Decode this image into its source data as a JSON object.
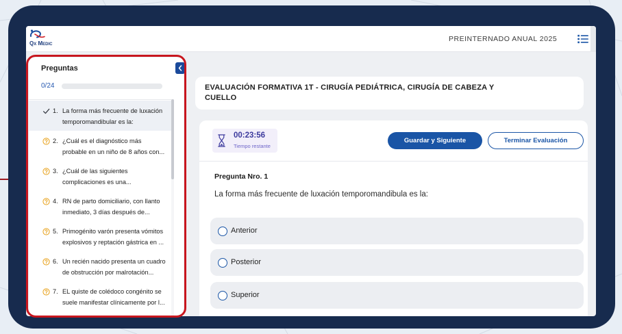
{
  "header": {
    "logo_text": "Qx Medic",
    "course_title": "PREINTERNADO ANUAL 2025",
    "menu_icon": "list-icon"
  },
  "sidebar": {
    "title": "Preguntas",
    "progress_text": "0/24",
    "progress_fraction": 0,
    "collapse_icon": "chevron-left-icon",
    "questions": [
      {
        "number": "1.",
        "lines": [
          "La forma más frecuente de luxación",
          "temporomandibular es la:"
        ],
        "icon": "check-icon",
        "active": true
      },
      {
        "number": "2.",
        "lines": [
          "¿Cuál es el diagnóstico más",
          "probable en un niño de 8 años con..."
        ],
        "icon": "question-circle-icon"
      },
      {
        "number": "3.",
        "lines": [
          "¿Cuál de las siguientes",
          "complicaciones es una..."
        ],
        "icon": "question-circle-icon"
      },
      {
        "number": "4.",
        "lines": [
          "RN de parto domiciliario, con llanto",
          "inmediato, 3 días después de..."
        ],
        "icon": "question-circle-icon"
      },
      {
        "number": "5.",
        "lines": [
          "Primogénito varón presenta vómitos",
          "explosivos y reptación gástrica en ..."
        ],
        "icon": "question-circle-icon"
      },
      {
        "number": "6.",
        "lines": [
          "Un recién nacido presenta un cuadro",
          "de obstrucción por malrotación..."
        ],
        "icon": "question-circle-icon"
      },
      {
        "number": "7.",
        "lines": [
          "EL quiste de colédoco congénito se",
          "suele manifestar clínicamente por l..."
        ],
        "icon": "question-circle-icon"
      }
    ]
  },
  "exam": {
    "title": "EVALUACIÓN FORMATIVA 1T - CIRUGÍA PEDIÁTRICA, CIRUGÍA DE CABEZA Y CUELLO",
    "timer": {
      "value": "00:23:56",
      "label": "Tiempo restante",
      "icon": "hourglass-icon"
    },
    "save_next_label": "Guardar y Siguiente",
    "finish_label": "Terminar Evaluación",
    "question_heading": "Pregunta Nro. 1",
    "question_text": "La forma más frecuente de luxación temporomandibula es la:",
    "options": [
      {
        "label": "Anterior"
      },
      {
        "label": "Posterior"
      },
      {
        "label": "Superior"
      }
    ]
  },
  "colors": {
    "primary": "#1a55a6",
    "highlight": "#c8161e",
    "frame": "#172b4e",
    "timer": "#3c3a9d",
    "count": "#2558b0",
    "pending": "#e8a21c"
  }
}
